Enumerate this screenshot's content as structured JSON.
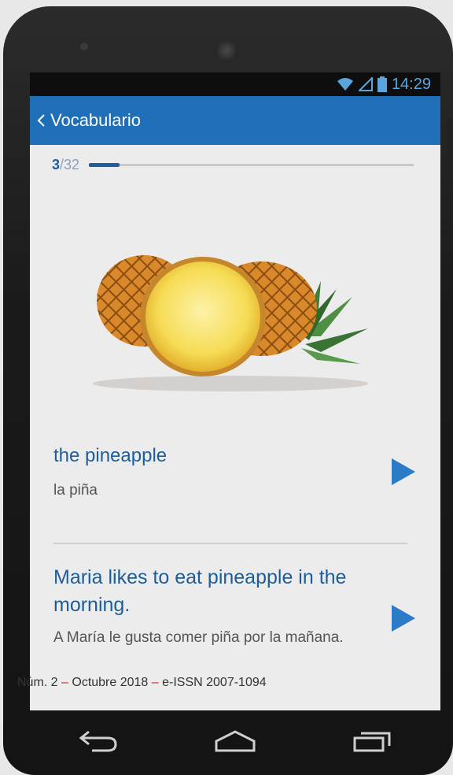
{
  "status_bar": {
    "time": "14:29",
    "icons": [
      "wifi-icon",
      "signal-icon",
      "battery-icon"
    ]
  },
  "app_bar": {
    "back_icon": "chevron-left-icon",
    "title": "Vocabulario"
  },
  "progress": {
    "current": "3",
    "total": "/32",
    "fraction": 0.094
  },
  "card": {
    "image": "pineapple-illustration",
    "word": "the pineapple",
    "word_translation": "la piña",
    "sentence": "Maria likes to eat pineapple in the morning.",
    "sentence_translation": "A María le gusta comer piña por la mañana.",
    "play_icon": "play-icon"
  },
  "caption": {
    "prefix": "Núm. 2 ",
    "dash": "–",
    "middle": " Octubre 2018 ",
    "dash2": "–",
    "suffix": " e-ISSN 2007-1094"
  },
  "nav_bar": {
    "icons": [
      "back-arrow-icon",
      "home-icon",
      "recent-apps-icon"
    ]
  },
  "colors": {
    "accent": "#1f6fb8",
    "text_blue": "#1d5d9b",
    "play": "#2b7bc7"
  }
}
